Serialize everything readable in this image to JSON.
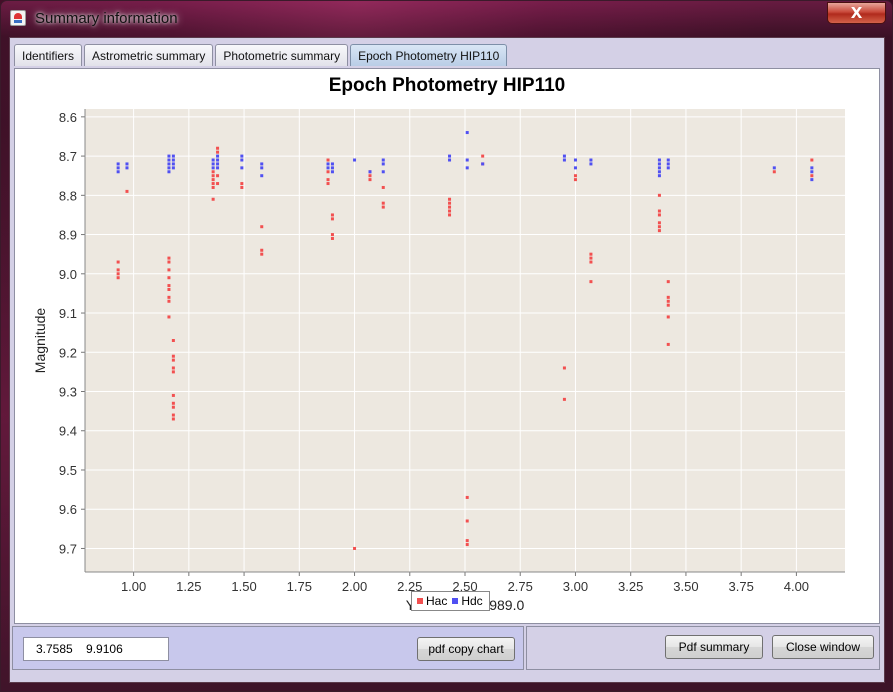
{
  "window": {
    "title": "Summary information",
    "close_glyph": "X"
  },
  "tabs": [
    {
      "label": "Identifiers",
      "active": false
    },
    {
      "label": "Astrometric summary",
      "active": false
    },
    {
      "label": "Photometric summary",
      "active": false
    },
    {
      "label": "Epoch Photometry HIP110",
      "active": true
    }
  ],
  "chart_data": {
    "type": "scatter",
    "title": "Epoch Photometry HIP110",
    "xlabel": "Years since 1989.0",
    "ylabel": "Magnitude",
    "xlim": [
      0.78,
      4.22
    ],
    "ylim": [
      8.58,
      9.76
    ],
    "y_inverted": true,
    "x_ticks": [
      "1.00",
      "1.25",
      "1.50",
      "1.75",
      "2.00",
      "2.25",
      "2.50",
      "2.75",
      "3.00",
      "3.25",
      "3.50",
      "3.75",
      "4.00"
    ],
    "y_ticks": [
      "8.6",
      "8.7",
      "8.8",
      "8.9",
      "9.0",
      "9.1",
      "9.2",
      "9.3",
      "9.4",
      "9.5",
      "9.6",
      "9.7"
    ],
    "grid": true,
    "legend_position": "bottom-center",
    "background_color": "#ede8e0",
    "series": [
      {
        "name": "Hac",
        "color": "#f25050",
        "points": [
          [
            0.93,
            8.97
          ],
          [
            0.93,
            8.99
          ],
          [
            0.93,
            9.0
          ],
          [
            0.93,
            9.01
          ],
          [
            0.97,
            8.79
          ],
          [
            1.16,
            8.96
          ],
          [
            1.16,
            8.97
          ],
          [
            1.16,
            8.99
          ],
          [
            1.16,
            9.01
          ],
          [
            1.16,
            9.03
          ],
          [
            1.16,
            9.04
          ],
          [
            1.16,
            9.06
          ],
          [
            1.16,
            9.07
          ],
          [
            1.16,
            9.11
          ],
          [
            1.18,
            9.17
          ],
          [
            1.18,
            9.21
          ],
          [
            1.18,
            9.22
          ],
          [
            1.18,
            9.24
          ],
          [
            1.18,
            9.25
          ],
          [
            1.18,
            9.31
          ],
          [
            1.18,
            9.33
          ],
          [
            1.18,
            9.34
          ],
          [
            1.18,
            9.36
          ],
          [
            1.18,
            9.37
          ],
          [
            1.36,
            8.74
          ],
          [
            1.36,
            8.75
          ],
          [
            1.36,
            8.76
          ],
          [
            1.36,
            8.77
          ],
          [
            1.36,
            8.78
          ],
          [
            1.36,
            8.81
          ],
          [
            1.38,
            8.68
          ],
          [
            1.38,
            8.69
          ],
          [
            1.38,
            8.75
          ],
          [
            1.38,
            8.77
          ],
          [
            1.49,
            8.77
          ],
          [
            1.49,
            8.78
          ],
          [
            1.58,
            8.88
          ],
          [
            1.58,
            8.94
          ],
          [
            1.58,
            8.95
          ],
          [
            1.88,
            8.71
          ],
          [
            1.88,
            8.74
          ],
          [
            1.88,
            8.76
          ],
          [
            1.88,
            8.77
          ],
          [
            1.9,
            8.85
          ],
          [
            1.9,
            8.86
          ],
          [
            1.9,
            8.9
          ],
          [
            1.9,
            8.91
          ],
          [
            2.0,
            9.7
          ],
          [
            2.07,
            8.74
          ],
          [
            2.07,
            8.75
          ],
          [
            2.07,
            8.76
          ],
          [
            2.13,
            8.78
          ],
          [
            2.13,
            8.82
          ],
          [
            2.13,
            8.83
          ],
          [
            2.43,
            8.81
          ],
          [
            2.43,
            8.82
          ],
          [
            2.43,
            8.83
          ],
          [
            2.43,
            8.84
          ],
          [
            2.43,
            8.85
          ],
          [
            2.51,
            9.57
          ],
          [
            2.51,
            9.63
          ],
          [
            2.51,
            9.68
          ],
          [
            2.51,
            9.69
          ],
          [
            2.58,
            8.7
          ],
          [
            2.58,
            8.72
          ],
          [
            2.95,
            9.24
          ],
          [
            2.95,
            9.32
          ],
          [
            3.0,
            8.75
          ],
          [
            3.0,
            8.76
          ],
          [
            3.07,
            8.95
          ],
          [
            3.07,
            8.96
          ],
          [
            3.07,
            8.97
          ],
          [
            3.07,
            9.02
          ],
          [
            3.38,
            8.8
          ],
          [
            3.38,
            8.84
          ],
          [
            3.38,
            8.85
          ],
          [
            3.38,
            8.87
          ],
          [
            3.38,
            8.88
          ],
          [
            3.38,
            8.89
          ],
          [
            3.42,
            9.02
          ],
          [
            3.42,
            9.06
          ],
          [
            3.42,
            9.07
          ],
          [
            3.42,
            9.08
          ],
          [
            3.42,
            9.11
          ],
          [
            3.42,
            9.18
          ],
          [
            3.9,
            8.74
          ],
          [
            4.07,
            8.71
          ],
          [
            4.07,
            8.75
          ]
        ]
      },
      {
        "name": "Hdc",
        "color": "#5050f2",
        "points": [
          [
            0.93,
            8.72
          ],
          [
            0.93,
            8.73
          ],
          [
            0.93,
            8.74
          ],
          [
            0.97,
            8.72
          ],
          [
            0.97,
            8.73
          ],
          [
            1.16,
            8.7
          ],
          [
            1.16,
            8.71
          ],
          [
            1.16,
            8.72
          ],
          [
            1.16,
            8.73
          ],
          [
            1.16,
            8.74
          ],
          [
            1.18,
            8.7
          ],
          [
            1.18,
            8.71
          ],
          [
            1.18,
            8.72
          ],
          [
            1.18,
            8.73
          ],
          [
            1.36,
            8.71
          ],
          [
            1.36,
            8.72
          ],
          [
            1.36,
            8.73
          ],
          [
            1.38,
            8.7
          ],
          [
            1.38,
            8.71
          ],
          [
            1.38,
            8.72
          ],
          [
            1.38,
            8.73
          ],
          [
            1.49,
            8.7
          ],
          [
            1.49,
            8.71
          ],
          [
            1.49,
            8.73
          ],
          [
            1.58,
            8.72
          ],
          [
            1.58,
            8.73
          ],
          [
            1.58,
            8.75
          ],
          [
            1.88,
            8.72
          ],
          [
            1.88,
            8.73
          ],
          [
            1.9,
            8.72
          ],
          [
            1.9,
            8.73
          ],
          [
            1.9,
            8.74
          ],
          [
            2.0,
            8.71
          ],
          [
            2.07,
            8.74
          ],
          [
            2.13,
            8.71
          ],
          [
            2.13,
            8.72
          ],
          [
            2.13,
            8.74
          ],
          [
            2.43,
            8.7
          ],
          [
            2.43,
            8.71
          ],
          [
            2.51,
            8.64
          ],
          [
            2.51,
            8.71
          ],
          [
            2.51,
            8.73
          ],
          [
            2.58,
            8.72
          ],
          [
            2.95,
            8.7
          ],
          [
            2.95,
            8.71
          ],
          [
            3.0,
            8.71
          ],
          [
            3.0,
            8.73
          ],
          [
            3.07,
            8.71
          ],
          [
            3.07,
            8.72
          ],
          [
            3.38,
            8.71
          ],
          [
            3.38,
            8.72
          ],
          [
            3.38,
            8.73
          ],
          [
            3.38,
            8.74
          ],
          [
            3.38,
            8.75
          ],
          [
            3.42,
            8.71
          ],
          [
            3.42,
            8.72
          ],
          [
            3.42,
            8.73
          ],
          [
            3.9,
            8.73
          ],
          [
            4.07,
            8.73
          ],
          [
            4.07,
            8.74
          ],
          [
            4.07,
            8.76
          ]
        ]
      }
    ]
  },
  "legend": {
    "hac_label": "Hac",
    "hdc_label": "Hdc"
  },
  "controls": {
    "cursor_readout": "3.7585    9.9106",
    "pdf_copy_chart": "pdf copy chart",
    "pdf_summary": "Pdf summary",
    "close_window": "Close window"
  }
}
